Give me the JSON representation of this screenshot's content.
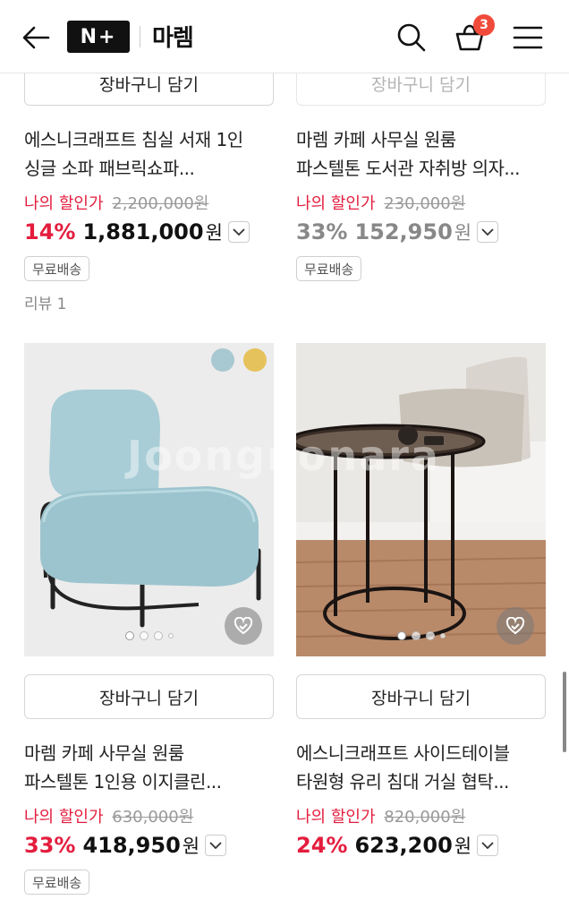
{
  "header": {
    "logo_text": "N+",
    "brand_name": "마렘",
    "cart_count": "3",
    "icons": [
      "back-arrow-icon",
      "search-icon",
      "cart-icon",
      "menu-icon"
    ]
  },
  "top_row": {
    "left": {
      "cart_button_label": "장바구니 담기",
      "title_line1": "에스니크래프트 침실 서재 1인",
      "title_line2": "싱글 소파 패브릭쇼파...",
      "discount_label": "나의 할인가",
      "original_price": "2,200,000원",
      "discount_pct": "14%",
      "price": "1,881,000",
      "currency": "원",
      "tag": "무료배송",
      "review": "리뷰 1"
    },
    "right": {
      "cart_button_label": "장바구니 담기",
      "title_line1": "마렘 카페 사무실 원룸",
      "title_line2": "파스텔톤 도서관 자취방 의자...",
      "discount_label": "나의 할인가",
      "original_price": "230,000원",
      "discount_pct": "33%",
      "price": "152,950",
      "currency": "원",
      "tag": "무료배송"
    }
  },
  "bottom_row": {
    "left": {
      "swatches": [
        "#a8c8d2",
        "#e6c25c"
      ],
      "watermark": "Joongnonara",
      "cart_button_label": "장바구니 담기",
      "title_line1": "마렘 카페 사무실 원룸",
      "title_line2": "파스텔톤 1인용 이지클린...",
      "discount_label": "나의 할인가",
      "original_price": "630,000원",
      "discount_pct": "33%",
      "price": "418,950",
      "currency": "원",
      "tag": "무료배송"
    },
    "right": {
      "cart_button_label": "장바구니 담기",
      "title_line1": "에스니크래프트 사이드테이블",
      "title_line2": "타원형 유리 침대 거실 협탁...",
      "discount_label": "나의 할인가",
      "original_price": "820,000원",
      "discount_pct": "24%",
      "price": "623,200",
      "currency": "원"
    }
  },
  "colors": {
    "accent_red": "#e41d3e",
    "badge": "#f04b3a",
    "chair_blue": "#a8cdd6"
  }
}
